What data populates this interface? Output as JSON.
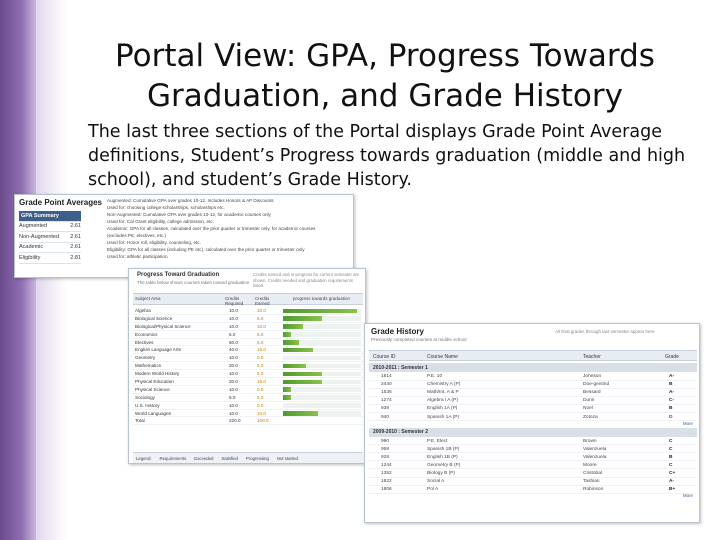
{
  "slide": {
    "title_line1": "Portal View: GPA, Progress Towards",
    "title_line2": "Graduation, and Grade History",
    "body": "The last three sections of the Portal displays Grade Point Average definitions, Student’s Progress towards graduation (middle and high school), and student’s Grade History."
  },
  "gpa": {
    "heading": "Grade Point Averages",
    "table_header": "GPA Summary",
    "rows": [
      {
        "label": "Augmented",
        "value": "2.61"
      },
      {
        "label": "Non-Augmented",
        "value": "2.61"
      },
      {
        "label": "Academic",
        "value": "2.61"
      },
      {
        "label": "Eligibility",
        "value": "2.81"
      }
    ],
    "definitions": [
      "Augmented: Cumulative GPA over grades 10-12. Includes Honors & AP Discounts",
      "Used for: choosing college scholarships, scholarships etc.",
      "Non-Augmented: Cumulative GPA over grades 10-12, for academic courses only",
      "Used for: Cal Grant eligibility, college admission, etc.",
      "Academic: GPA for all classes, calculated over the prior quarter or trimester only, for academic courses",
      "(excludes PE, electives, etc.)",
      "Used for: Honor roll, eligibility, counseling, etc.",
      "Eligibility: GPA for all classes (including PE etc), calculated over the prior quarter or trimester only",
      "Used for: athletic participation"
    ]
  },
  "progress": {
    "title": "Progress Toward Graduation",
    "subtitle": "The table below shows courses taken toward graduation",
    "note": "Credits earned and in-progress for current semester are shown. Credits needed and graduation requirements listed.",
    "headers": [
      "Subject Area",
      "Credits Required",
      "Credits Earned",
      "progress towards graduation"
    ],
    "rows": [
      {
        "subject": "Algebra",
        "req": "10.0",
        "earned": "10.0",
        "pct": 0.95
      },
      {
        "subject": "Biological Science",
        "req": "10.0",
        "earned": "5.0",
        "pct": 0.5
      },
      {
        "subject": "Biological/Physical Science",
        "req": "10.0",
        "earned": "10.0",
        "pct": 0.25
      },
      {
        "subject": "Economics",
        "req": "5.0",
        "earned": "5.0",
        "pct": 0.1
      },
      {
        "subject": "Electives",
        "req": "60.0",
        "earned": "5.0",
        "pct": 0.2
      },
      {
        "subject": "English Language Arts",
        "req": "40.0",
        "earned": "15.0",
        "pct": 0.38
      },
      {
        "subject": "Geometry",
        "req": "10.0",
        "earned": "0.0",
        "pct": 0.0
      },
      {
        "subject": "Mathematics",
        "req": "20.0",
        "earned": "5.0",
        "pct": 0.3
      },
      {
        "subject": "Modern World History",
        "req": "10.0",
        "earned": "5.0",
        "pct": 0.5
      },
      {
        "subject": "Physical Education",
        "req": "20.0",
        "earned": "15.0",
        "pct": 0.5
      },
      {
        "subject": "Physical Science",
        "req": "10.0",
        "earned": "0.0",
        "pct": 0.1
      },
      {
        "subject": "Sociology",
        "req": "5.0",
        "earned": "5.0",
        "pct": 0.1
      },
      {
        "subject": "U.S. History",
        "req": "10.0",
        "earned": "0.0",
        "pct": 0.0
      },
      {
        "subject": "World Languages",
        "req": "10.0",
        "earned": "10.0",
        "pct": 0.45
      },
      {
        "subject": "Total",
        "req": "220.0",
        "earned": "100.0",
        "pct": 0.0
      }
    ],
    "legend": [
      "Legend:",
      "Requirements",
      "Exceeded",
      "Satisfied",
      "Progressing",
      "Not started"
    ]
  },
  "history": {
    "title": "Grade History",
    "subtitle": "Previously completed courses at middle school",
    "note": "All final grades through last semester appear here",
    "headers": [
      "Course ID",
      "Course Name",
      "Teacher",
      "Grade"
    ],
    "sem1": "2010-2011 : Semester 1",
    "sem1_rows": [
      {
        "id": "1814",
        "name": "P.E. 10",
        "teacher": "Johnson",
        "grade": "A-",
        "red": false
      },
      {
        "id": "2440",
        "name": "Chemistry A (P)",
        "teacher": "Doe-gentind",
        "grade": "B",
        "red": false
      },
      {
        "id": "1536",
        "name": "Math/Int. A & P",
        "teacher": "Bessard",
        "grade": "A-",
        "red": false
      },
      {
        "id": "1274",
        "name": "Algebra I A (P)",
        "teacher": "Dunn",
        "grade": "C-",
        "red": false
      },
      {
        "id": "938",
        "name": "English 1A (P)",
        "teacher": "Noel",
        "grade": "B",
        "red": false
      },
      {
        "id": "940",
        "name": "Spanish 1A (P)",
        "teacher": "Zotoza",
        "grade": "D",
        "red": true
      }
    ],
    "sem2": "2009-2010 : Semester 2",
    "sem2_rows": [
      {
        "id": "990",
        "name": "P.E. Elect",
        "teacher": "Brown",
        "grade": "C",
        "red": false
      },
      {
        "id": "958",
        "name": "Spanish 1B (P)",
        "teacher": "Valenzuela",
        "grade": "C",
        "red": false
      },
      {
        "id": "928",
        "name": "English 1B (P)",
        "teacher": "Valenzuela",
        "grade": "B",
        "red": false
      },
      {
        "id": "1244",
        "name": "Geometry B (P)",
        "teacher": "Moore",
        "grade": "C",
        "red": false
      },
      {
        "id": "1352",
        "name": "Biology B (P)",
        "teacher": "Cristobal",
        "grade": "C+",
        "red": false
      },
      {
        "id": "1822",
        "name": "Social A",
        "teacher": "Tashian",
        "grade": "A-",
        "red": false
      },
      {
        "id": "1806",
        "name": "Pol A",
        "teacher": "Robinson",
        "grade": "B+",
        "red": false
      }
    ],
    "more_label": "More"
  }
}
